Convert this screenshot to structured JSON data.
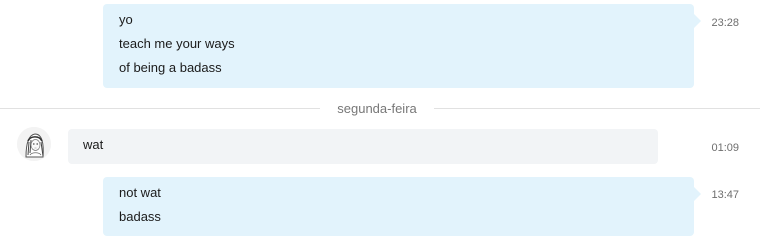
{
  "messages": [
    {
      "direction": "outgoing",
      "lines": [
        "yo",
        "teach me your ways",
        "of being a badass"
      ],
      "time": "23:28"
    },
    {
      "direction": "incoming",
      "lines": [
        "wat"
      ],
      "time": "01:09"
    },
    {
      "direction": "outgoing",
      "lines": [
        "not wat",
        "badass"
      ],
      "time": "13:47"
    }
  ],
  "day_separator": "segunda-feira",
  "colors": {
    "outgoing_bubble": "#e2f3fc",
    "incoming_bubble": "#f2f4f6",
    "timestamp": "#6e6e6e",
    "divider": "#e1e1e1"
  },
  "icons": {
    "avatar": "user-avatar-sketch"
  }
}
